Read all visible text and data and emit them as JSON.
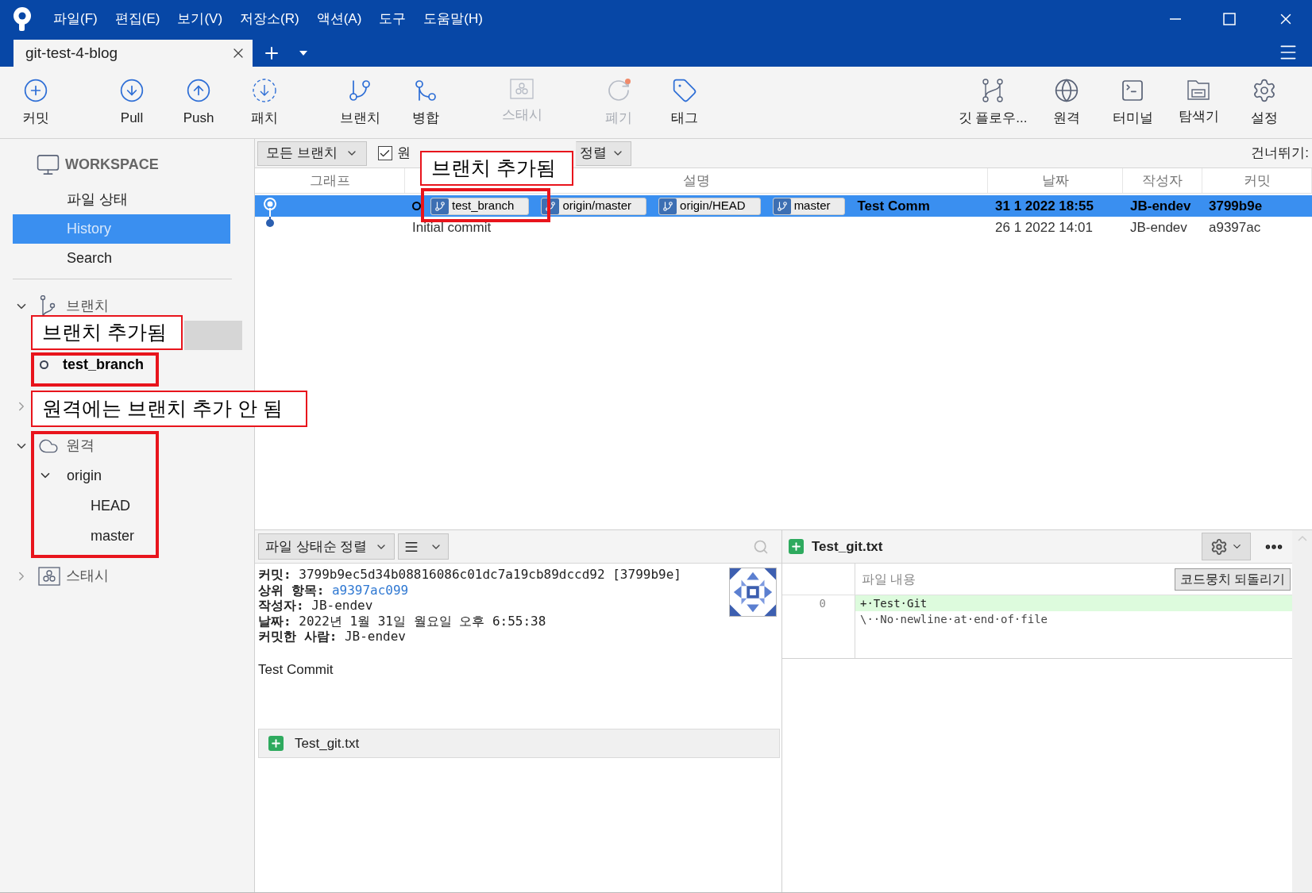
{
  "window": {
    "menu": [
      "파일(F)",
      "편집(E)",
      "보기(V)",
      "저장소(R)",
      "액션(A)",
      "도구",
      "도움말(H)"
    ]
  },
  "tabs": [
    {
      "label": "git-test-4-blog",
      "selected": true
    }
  ],
  "toolbar": {
    "left": [
      {
        "label": "커밋",
        "kind": "commit",
        "disabled": false
      },
      {
        "label": "Pull",
        "kind": "pull",
        "disabled": false
      },
      {
        "label": "Push",
        "kind": "push",
        "disabled": false
      },
      {
        "label": "패치",
        "kind": "fetch",
        "disabled": false
      },
      {
        "label": "브랜치",
        "kind": "branch",
        "disabled": false
      },
      {
        "label": "병합",
        "kind": "merge",
        "disabled": false
      },
      {
        "label": "스태시",
        "kind": "stash",
        "disabled": true
      },
      {
        "label": "폐기",
        "kind": "discard",
        "disabled": true
      },
      {
        "label": "태그",
        "kind": "tag",
        "disabled": false
      }
    ],
    "right": [
      {
        "label": "깃 플로우...",
        "kind": "gitflow",
        "disabled": false
      },
      {
        "label": "원격",
        "kind": "remote",
        "disabled": false
      },
      {
        "label": "터미널",
        "kind": "terminal",
        "disabled": false
      },
      {
        "label": "탐색기",
        "kind": "explorer",
        "disabled": false
      },
      {
        "label": "설정",
        "kind": "settings",
        "disabled": false
      }
    ]
  },
  "sidebar": {
    "workspace": {
      "title": "WORKSPACE",
      "items": [
        {
          "label": "파일 상태",
          "selected": false
        },
        {
          "label": "History",
          "selected": true
        },
        {
          "label": "Search",
          "selected": false
        }
      ]
    },
    "sections": [
      {
        "kind": "branches",
        "label": "브랜치",
        "expanded": true,
        "items": [
          {
            "selected": true
          },
          {
            "label": "test_branch",
            "current": true,
            "selected": false
          }
        ]
      },
      {
        "kind": "tags",
        "expanded": false
      },
      {
        "kind": "remotes",
        "label": "원격",
        "expanded": true,
        "items": [
          {
            "label": "origin",
            "expanded": true,
            "children": [
              {
                "label": "HEAD"
              },
              {
                "label": "master"
              }
            ]
          }
        ]
      },
      {
        "kind": "stashes",
        "label": "스태시",
        "expanded": false
      }
    ]
  },
  "filter_bar": {
    "branch_filter": "모든 브랜치",
    "remote_checkbox": {
      "label": "원",
      "checked": true
    },
    "sort": "정렬",
    "skip_label": "건너뛰기:"
  },
  "history": {
    "columns": [
      "그래프",
      "설명",
      "날짜",
      "작성자",
      "커밋"
    ],
    "rows": [
      {
        "kind": "head",
        "selected": true,
        "current": true,
        "refs": [
          "test_branch",
          "origin/master",
          "origin/HEAD",
          "master"
        ],
        "message": "Test Comm",
        "date": "31 1 2022 18:55",
        "author": "JB-endev",
        "commit": "3799b9e"
      },
      {
        "kind": "commit",
        "selected": false,
        "current": false,
        "message": "Initial commit",
        "date": "26 1 2022 14:01",
        "author": "JB-endev",
        "commit": "a9397ac"
      }
    ]
  },
  "commit_details": {
    "sort_dropdown": "파일 상태순 정렬",
    "fields": [
      {
        "label": "커밋:",
        "value": "3799b9ec5d34b08816086c01dc7a19cb89dccd92 [3799b9e]",
        "kind": "text"
      },
      {
        "label": "상위 항목:",
        "value": "a9397ac099",
        "kind": "link"
      },
      {
        "label": "작성자:",
        "value": "JB-endev",
        "kind": "text"
      },
      {
        "label": "날짜:",
        "value": "2022년 1월 31일 월요일 오후 6:55:38",
        "kind": "text"
      },
      {
        "label": "커밋한 사람:",
        "value": "JB-endev",
        "kind": "text"
      }
    ],
    "message": "Test Commit",
    "files": [
      {
        "name": "Test_git.txt",
        "kind": "added"
      }
    ]
  },
  "diff": {
    "file": {
      "name": "Test_git.txt",
      "kind": "added"
    },
    "header": "파일 내용",
    "revert_button": "코드뭉치 되돌리기",
    "lines": [
      {
        "number": "0",
        "text": "+·Test·Git",
        "kind": "added"
      },
      {
        "text": "\\··No·newline·at·end·of·file",
        "kind": "context"
      }
    ]
  },
  "annotations": [
    {
      "kind": "callout",
      "text": "브랜치 추가됨"
    },
    {
      "kind": "highlight"
    },
    {
      "kind": "callout",
      "text": "브랜치 추가됨"
    },
    {
      "kind": "highlight"
    },
    {
      "kind": "callout",
      "text": "원격에는 브랜치 추가 안 됨"
    },
    {
      "kind": "highlight"
    }
  ]
}
